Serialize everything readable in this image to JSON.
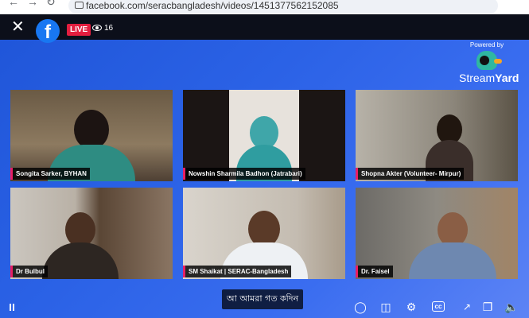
{
  "browser": {
    "url": "facebook.com/seracbangladesh/videos/1451377562152085"
  },
  "player": {
    "live_label": "LIVE",
    "viewer_count": "16",
    "powered_by": "Powered by",
    "brand_stream": "Stream",
    "brand_yard": "Yard",
    "caption": "আ আমরা গত কদিন"
  },
  "participants": [
    {
      "name": "Songita Sarker, BYHAN"
    },
    {
      "name": "Nowshin Sharmila Badhon (Jatrabari)"
    },
    {
      "name": "Shopna Akter (Volunteer- Mirpur)"
    },
    {
      "name": "Dr Bulbul"
    },
    {
      "name": "SM Shaikat | SERAC-Bangladesh"
    },
    {
      "name": "Dr. Faisel"
    }
  ],
  "controls": {
    "icons": [
      "pause-icon",
      "comment-icon",
      "clip-icon",
      "settings-icon",
      "captions-icon",
      "expand-icon",
      "pip-icon",
      "volume-icon"
    ],
    "cc_label": "cc"
  },
  "colors": {
    "live": "#e41e3f",
    "facebook": "#1877f2",
    "name_accent": "#e91e63",
    "stage": "#2b62e6"
  }
}
